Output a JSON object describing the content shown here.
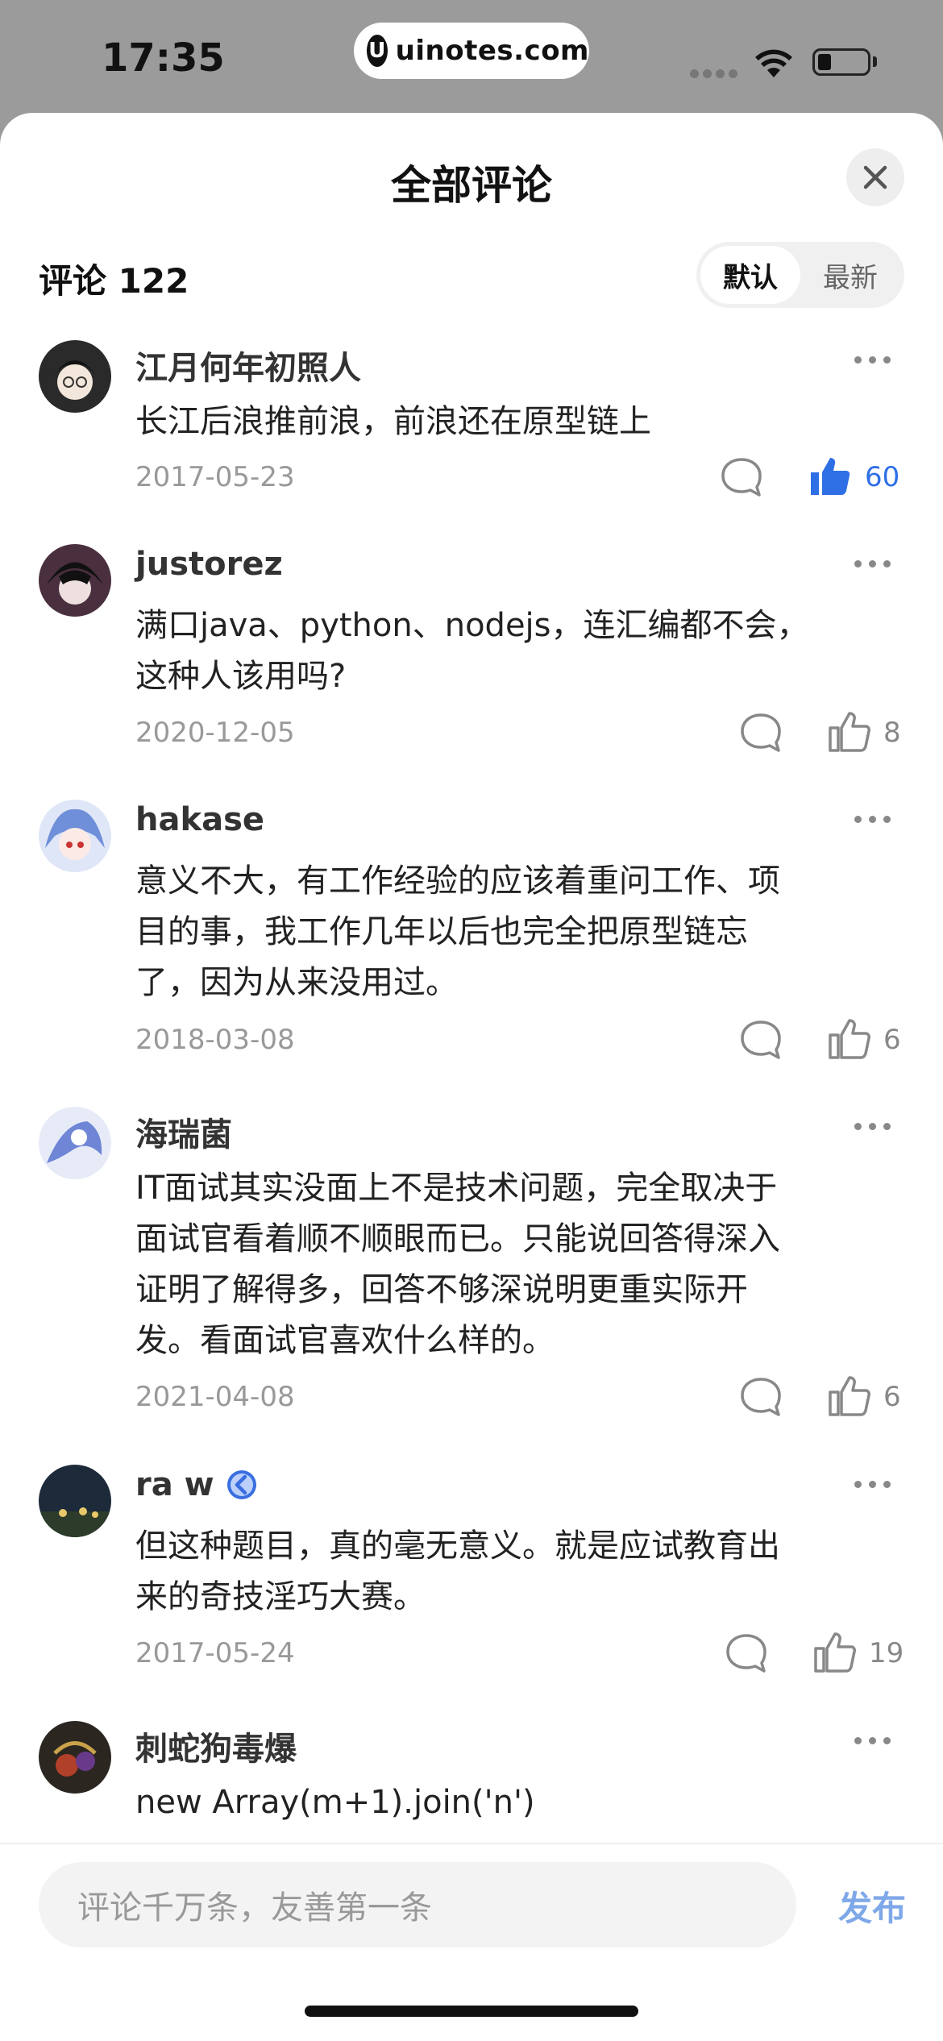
{
  "status_bar": {
    "time": "17:35",
    "url": "uinotes.com",
    "url_logo": "U",
    "battery_level": 0.28
  },
  "sheet": {
    "title": "全部评论",
    "comment_count": "评论 122",
    "sort_options": [
      "默认",
      "最新"
    ],
    "sort_selected": "默认"
  },
  "comments": [
    {
      "name": "江月何年初照人",
      "text_lines": [
        "长江后浪推前浪，前浪还在原型链上"
      ],
      "date": "2017-05-23",
      "likes": "60",
      "liked": true,
      "avatar_color": "#2a2a2a"
    },
    {
      "name": "justorez",
      "text_lines": [
        "满口java、python、nodejs，连汇编都不会，",
        "这种人该用吗?"
      ],
      "date": "2020-12-05",
      "likes": "8",
      "liked": false,
      "avatar_color": "#3b2a36"
    },
    {
      "name": "hakase",
      "text_lines": [
        "意义不大，有工作经验的应该着重问工作、项",
        "目的事，我工作几年以后也完全把原型链忘",
        "了，因为从来没用过。"
      ],
      "date": "2018-03-08",
      "likes": "6",
      "liked": false,
      "avatar_color": "#c9d3ee"
    },
    {
      "name": "海瑞菌",
      "text_lines": [
        "IT面试其实没面上不是技术问题，完全取决于",
        "面试官看着顺不顺眼而已。只能说回答得深入",
        "证明了解得多，回答不够深说明更重实际开",
        "发。看面试官喜欢什么样的。"
      ],
      "date": "2021-04-08",
      "likes": "6",
      "liked": false,
      "avatar_color": "#7d8fd0"
    },
    {
      "name": "ra w",
      "text_lines": [
        "但这种题目，真的毫无意义。就是应试教育出",
        "来的奇技淫巧大赛。"
      ],
      "date": "2017-05-24",
      "likes": "19",
      "liked": false,
      "avatar_color": "#1f2c3a",
      "badge": true
    },
    {
      "name": "刺蛇狗毒爆",
      "text_lines": [
        " new Array(m+1).join('n')"
      ],
      "date": "",
      "likes": "",
      "liked": false,
      "avatar_color": "#2b2620"
    }
  ],
  "composer": {
    "placeholder": "评论千万条，友善第一条",
    "publish_label": "发布"
  },
  "colors": {
    "accent": "#2f6fe6",
    "publish": "#7fa8e8"
  }
}
